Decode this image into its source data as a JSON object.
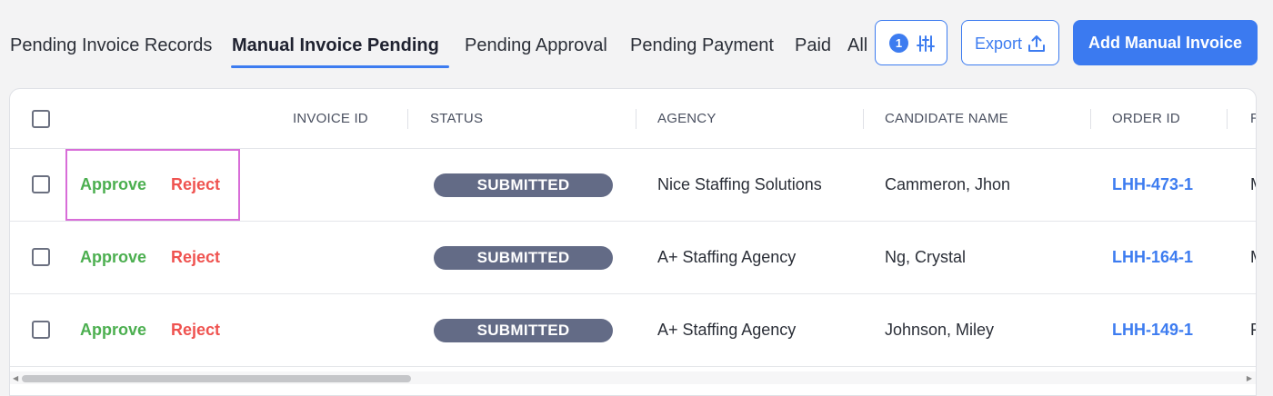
{
  "tabs": [
    {
      "label": "Pending Invoice Records",
      "active": false
    },
    {
      "label": "Manual Invoice Pending",
      "active": true
    },
    {
      "label": "Pending Approval",
      "active": false
    },
    {
      "label": "Pending Payment",
      "active": false
    },
    {
      "label": "Paid",
      "active": false
    },
    {
      "label": "All",
      "active": false
    }
  ],
  "toolbar": {
    "filter_count": "1",
    "filter_icon": "sliders-icon",
    "export_label": "Export",
    "export_icon": "upload-icon",
    "add_label": "Add Manual Invoice"
  },
  "table": {
    "columns": [
      "INVOICE ID",
      "STATUS",
      "AGENCY",
      "CANDIDATE NAME",
      "ORDER ID",
      "R"
    ],
    "approve_label": "Approve",
    "reject_label": "Reject",
    "rows": [
      {
        "invoice_id": "",
        "status": "SUBMITTED",
        "agency": "Nice Staffing Solutions",
        "candidate": "Cammeron, Jhon",
        "order_id": "LHH-473-1",
        "next": "M"
      },
      {
        "invoice_id": "",
        "status": "SUBMITTED",
        "agency": "A+ Staffing Agency",
        "candidate": "Ng, Crystal",
        "order_id": "LHH-164-1",
        "next": "M"
      },
      {
        "invoice_id": "",
        "status": "SUBMITTED",
        "agency": "A+ Staffing Agency",
        "candidate": "Johnson, Miley",
        "order_id": "LHH-149-1",
        "next": "F"
      }
    ]
  },
  "colors": {
    "accent": "#3d7cf0",
    "approve": "#4caf50",
    "reject": "#ef5350",
    "badge": "#636b86",
    "highlight": "#d86dd8"
  }
}
